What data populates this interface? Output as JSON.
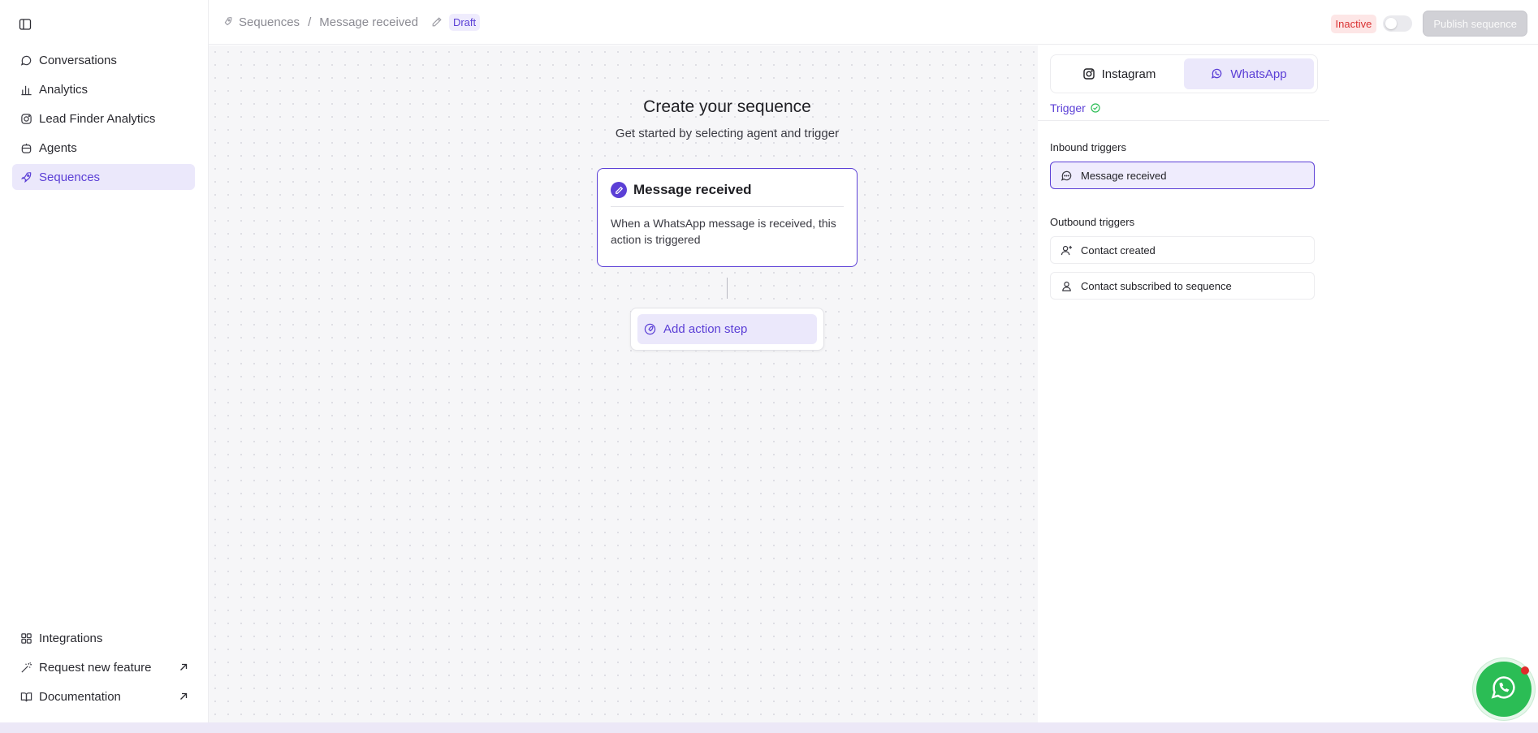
{
  "sidebar": {
    "toggle_icon": "sidebar-toggle-icon",
    "items": [
      {
        "label": "Conversations",
        "icon": "chat-icon",
        "active": false
      },
      {
        "label": "Analytics",
        "icon": "bar-chart-icon",
        "active": false
      },
      {
        "label": "Lead Finder Analytics",
        "icon": "instagram-icon",
        "active": false
      },
      {
        "label": "Agents",
        "icon": "bot-icon",
        "active": false
      },
      {
        "label": "Sequences",
        "icon": "rocket-icon",
        "active": true
      }
    ],
    "bottom_items": [
      {
        "label": "Integrations",
        "icon": "grid-icon"
      },
      {
        "label": "Request new feature",
        "icon": "wand-icon"
      },
      {
        "label": "Documentation",
        "icon": "book-icon"
      }
    ]
  },
  "header": {
    "breadcrumb": [
      "Sequences",
      "Message received"
    ],
    "separator": "/",
    "status_badge": "Draft",
    "active_status": "Inactive",
    "publish_label": "Publish sequence"
  },
  "canvas": {
    "title": "Create your sequence",
    "subtitle": "Get started by selecting agent and trigger",
    "trigger_card": {
      "title": "Message received",
      "description": "When a WhatsApp message is received, this action is triggered"
    },
    "add_step_label": "Add action step"
  },
  "panel": {
    "channels": [
      {
        "label": "Instagram",
        "icon": "instagram-icon",
        "active": false
      },
      {
        "label": "WhatsApp",
        "icon": "whatsapp-icon",
        "active": true
      }
    ],
    "trigger_tab": "Trigger",
    "inbound_title": "Inbound triggers",
    "inbound": [
      {
        "label": "Message received",
        "icon": "message-icon",
        "selected": true
      }
    ],
    "outbound_title": "Outbound triggers",
    "outbound": [
      {
        "label": "Contact created",
        "icon": "user-plus-icon"
      },
      {
        "label": "Contact subscribed to sequence",
        "icon": "user-icon"
      }
    ]
  },
  "colors": {
    "accent": "#5b3fd6",
    "accent_soft": "#ebe8fb",
    "danger": "#d93232",
    "whatsapp": "#2bbd55"
  }
}
